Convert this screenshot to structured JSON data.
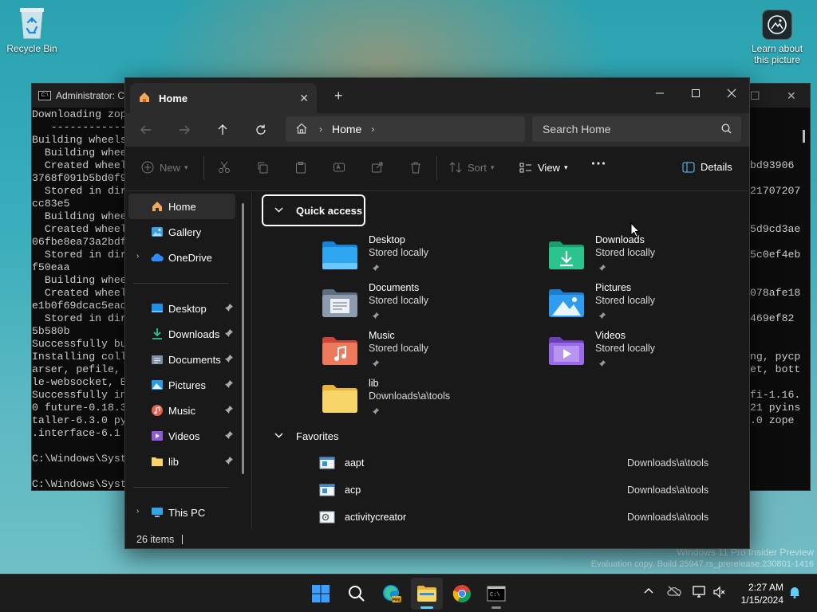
{
  "desktop": {
    "recycle_bin": "Recycle Bin",
    "learn_about_line1": "Learn about",
    "learn_about_line2": "this picture",
    "watermark_line1": "Windows 11 Pro Insider Preview",
    "watermark_line2": "Evaluation copy. Build 25947.rs_prerelease.230801-1416"
  },
  "terminal": {
    "title": "Administrator: C",
    "lines": [
      "Downloading zop",
      "   ------------",
      "Building wheels",
      "  Building whee",
      "  Created wheel",
      "3768f091b5bd0f9",
      "  Stored in dir",
      "cc83e5",
      "  Building whee",
      "  Created wheel",
      "06fbe8ea73a2bdf",
      "  Stored in dir",
      "f50eaa",
      "  Building whee",
      "  Created wheel",
      "e1b0f69dcac5ead",
      "  Stored in dir",
      "5b580b",
      "Successfully bu",
      "Installing coll",
      "arser, pefile, ",
      "le-websocket, E",
      "Successfully in",
      "0 future-0.18.3",
      "taller-6.3.0 py",
      ".interface-6.1",
      "",
      "C:\\Windows\\Syst",
      "",
      "C:\\Windows\\Syst"
    ],
    "right_lines": [
      "bd93906",
      "",
      "21707207",
      "",
      "",
      "5d9cd3ae",
      "",
      "5c0ef4eb",
      "",
      "",
      "078afe18",
      "",
      "469ef82",
      "",
      "",
      "ng, pycp",
      "et, bott",
      "",
      "fi-1.16.",
      "21 pyins",
      ".0 zope"
    ]
  },
  "explorer": {
    "tab_title": "Home",
    "address": {
      "crumb": "Home"
    },
    "search": {
      "placeholder": "Search Home"
    },
    "commands": {
      "new": "New",
      "sort": "Sort",
      "view": "View",
      "details": "Details"
    },
    "sidebar": {
      "items": [
        {
          "label": "Home"
        },
        {
          "label": "Gallery"
        },
        {
          "label": "OneDrive"
        },
        {
          "label": "Desktop"
        },
        {
          "label": "Downloads"
        },
        {
          "label": "Documents"
        },
        {
          "label": "Pictures"
        },
        {
          "label": "Music"
        },
        {
          "label": "Videos"
        },
        {
          "label": "lib"
        },
        {
          "label": "This PC"
        }
      ]
    },
    "quick_access": {
      "title": "Quick access",
      "tiles": [
        {
          "name": "Desktop",
          "sub": "Stored locally"
        },
        {
          "name": "Downloads",
          "sub": "Stored locally"
        },
        {
          "name": "Documents",
          "sub": "Stored locally"
        },
        {
          "name": "Pictures",
          "sub": "Stored locally"
        },
        {
          "name": "Music",
          "sub": "Stored locally"
        },
        {
          "name": "Videos",
          "sub": "Stored locally"
        },
        {
          "name": "lib",
          "sub": "Downloads\\a\\tools"
        }
      ]
    },
    "favorites": {
      "title": "Favorites",
      "rows": [
        {
          "name": "aapt",
          "location": "Downloads\\a\\tools"
        },
        {
          "name": "acp",
          "location": "Downloads\\a\\tools"
        },
        {
          "name": "activitycreator",
          "location": "Downloads\\a\\tools"
        }
      ]
    },
    "status": {
      "count": "26 items"
    }
  },
  "taskbar": {
    "time": "2:27 AM",
    "date": "1/15/2024"
  },
  "colors": {
    "accent": "#60cdff",
    "folder_yellow": "#f8d568",
    "window_bg": "#191919"
  }
}
